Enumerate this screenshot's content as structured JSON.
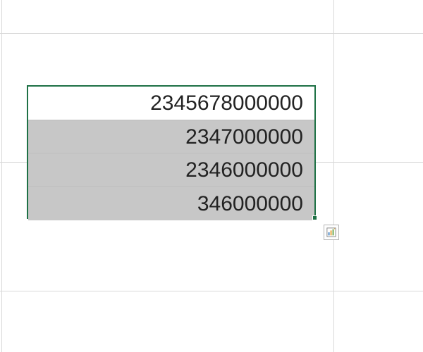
{
  "cells": {
    "r0": "2345678000000",
    "r1": "2347000000",
    "r2": "2346000000",
    "r3": "346000000"
  },
  "icons": {
    "quick_analysis": "quick-analysis"
  }
}
